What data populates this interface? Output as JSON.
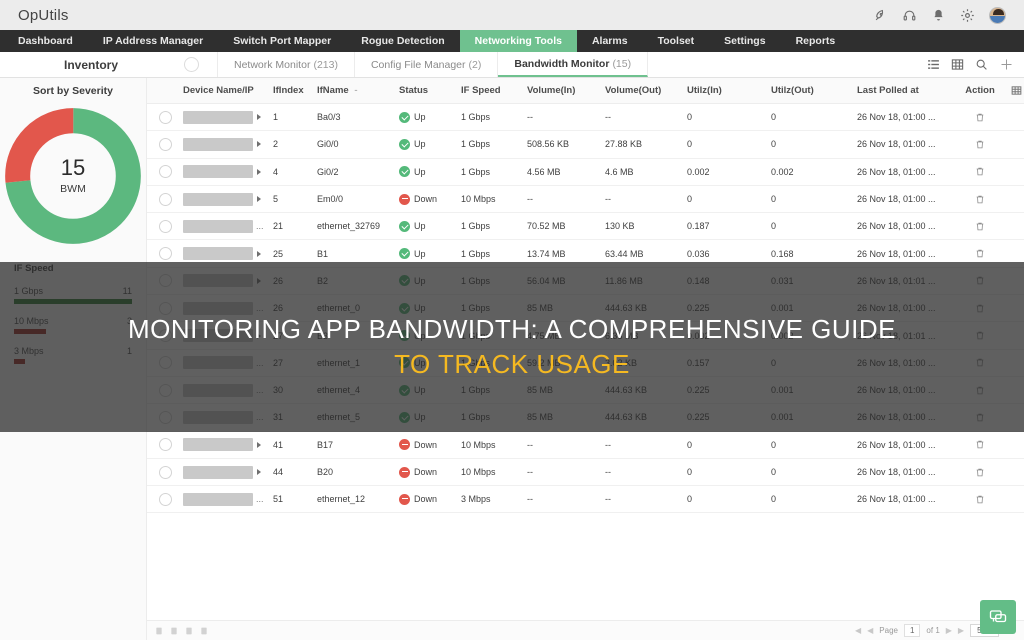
{
  "brand": {
    "name": "OpUtils"
  },
  "top_icons": [
    {
      "name": "rocket-icon"
    },
    {
      "name": "headset-icon"
    },
    {
      "name": "bell-icon"
    },
    {
      "name": "gear-icon"
    },
    {
      "name": "avatar"
    }
  ],
  "nav": {
    "items": [
      {
        "label": "Dashboard",
        "active": false
      },
      {
        "label": "IP Address Manager",
        "active": false
      },
      {
        "label": "Switch Port Mapper",
        "active": false
      },
      {
        "label": "Rogue Detection",
        "active": false
      },
      {
        "label": "Networking Tools",
        "active": true
      },
      {
        "label": "Alarms",
        "active": false
      },
      {
        "label": "Toolset",
        "active": false
      },
      {
        "label": "Settings",
        "active": false
      },
      {
        "label": "Reports",
        "active": false
      }
    ],
    "active_color": "#6fc18f"
  },
  "subbar": {
    "inventory_label": "Inventory",
    "tabs": [
      {
        "label": "Network Monitor",
        "count": "(213)",
        "active": false
      },
      {
        "label": "Config File Manager",
        "count": "(2)",
        "active": false
      },
      {
        "label": "Bandwidth Monitor",
        "count": "(15)",
        "active": true
      }
    ],
    "icons": [
      {
        "name": "list-view-icon"
      },
      {
        "name": "grid-view-icon"
      },
      {
        "name": "search-icon"
      },
      {
        "name": "add-icon"
      }
    ]
  },
  "sidebar": {
    "sort_title": "Sort by Severity",
    "donut": {
      "total": "15",
      "unit": "BWM",
      "segments": [
        {
          "label": "Up",
          "value": 11,
          "color": "#5cb87f"
        },
        {
          "label": "Down",
          "value": 4,
          "color": "#e2574c"
        }
      ]
    },
    "ifspeed": {
      "title": "IF Speed",
      "rows": [
        {
          "label": "1 Gbps",
          "count": "11",
          "pct": 100,
          "color": "#2e7d32"
        },
        {
          "label": "10 Mbps",
          "count": "3",
          "pct": 27,
          "color": "#9e2b25"
        },
        {
          "label": "3 Mbps",
          "count": "1",
          "pct": 9,
          "color": "#9e2b25"
        }
      ]
    }
  },
  "table": {
    "columns": [
      "Device Name/IP",
      "IfIndex",
      "IfName",
      "Status",
      "IF Speed",
      "Volume(In)",
      "Volume(Out)",
      "Utilz(In)",
      "Utilz(Out)",
      "Last Polled at",
      "Action"
    ],
    "sorted_column": "IfName",
    "rows": [
      {
        "ifindex": "1",
        "ifname": "Ba0/3",
        "status": "Up",
        "speed": "1 Gbps",
        "vol_in": "--",
        "vol_out": "--",
        "utl_in": "0",
        "utl_out": "0",
        "polled": "26 Nov 18, 01:00 ...",
        "truncated": false
      },
      {
        "ifindex": "2",
        "ifname": "Gi0/0",
        "status": "Up",
        "speed": "1 Gbps",
        "vol_in": "508.56 KB",
        "vol_out": "27.88 KB",
        "utl_in": "0",
        "utl_out": "0",
        "polled": "26 Nov 18, 01:00 ...",
        "truncated": false
      },
      {
        "ifindex": "4",
        "ifname": "Gi0/2",
        "status": "Up",
        "speed": "1 Gbps",
        "vol_in": "4.56 MB",
        "vol_out": "4.6 MB",
        "utl_in": "0.002",
        "utl_out": "0.002",
        "polled": "26 Nov 18, 01:00 ...",
        "truncated": false
      },
      {
        "ifindex": "5",
        "ifname": "Em0/0",
        "status": "Down",
        "speed": "10 Mbps",
        "vol_in": "--",
        "vol_out": "--",
        "utl_in": "0",
        "utl_out": "0",
        "polled": "26 Nov 18, 01:00 ...",
        "truncated": false
      },
      {
        "ifindex": "21",
        "ifname": "ethernet_32769",
        "status": "Up",
        "speed": "1 Gbps",
        "vol_in": "70.52 MB",
        "vol_out": "130 KB",
        "utl_in": "0.187",
        "utl_out": "0",
        "polled": "26 Nov 18, 01:00 ...",
        "truncated": true
      },
      {
        "ifindex": "25",
        "ifname": "B1",
        "status": "Up",
        "speed": "1 Gbps",
        "vol_in": "13.74 MB",
        "vol_out": "63.44 MB",
        "utl_in": "0.036",
        "utl_out": "0.168",
        "polled": "26 Nov 18, 01:00 ...",
        "truncated": false
      },
      {
        "ifindex": "26",
        "ifname": "B2",
        "status": "Up",
        "speed": "1 Gbps",
        "vol_in": "56.04 MB",
        "vol_out": "11.86 MB",
        "utl_in": "0.148",
        "utl_out": "0.031",
        "polled": "26 Nov 18, 01:01 ...",
        "truncated": false
      },
      {
        "ifindex": "26",
        "ifname": "ethernet_0",
        "status": "Up",
        "speed": "1 Gbps",
        "vol_in": "85 MB",
        "vol_out": "444.63 KB",
        "utl_in": "0.225",
        "utl_out": "0.001",
        "polled": "26 Nov 18, 01:00 ...",
        "truncated": true
      },
      {
        "ifindex": "27",
        "ifname": "B3",
        "status": "Up",
        "speed": "1 Gbps",
        "vol_in": "4.75 MB",
        "vol_out": "6.33 MB",
        "utl_in": "0.002",
        "utl_out": "0.002",
        "polled": "26 Nov 18, 01:01 ...",
        "truncated": false
      },
      {
        "ifindex": "27",
        "ifname": "ethernet_1",
        "status": "Up",
        "speed": "1 Gbps",
        "vol_in": "59.2 MB",
        "vol_out": "3.02 KB",
        "utl_in": "0.157",
        "utl_out": "0",
        "polled": "26 Nov 18, 01:00 ...",
        "truncated": true
      },
      {
        "ifindex": "30",
        "ifname": "ethernet_4",
        "status": "Up",
        "speed": "1 Gbps",
        "vol_in": "85 MB",
        "vol_out": "444.63 KB",
        "utl_in": "0.225",
        "utl_out": "0.001",
        "polled": "26 Nov 18, 01:00 ...",
        "truncated": true
      },
      {
        "ifindex": "31",
        "ifname": "ethernet_5",
        "status": "Up",
        "speed": "1 Gbps",
        "vol_in": "85 MB",
        "vol_out": "444.63 KB",
        "utl_in": "0.225",
        "utl_out": "0.001",
        "polled": "26 Nov 18, 01:00 ...",
        "truncated": true
      },
      {
        "ifindex": "41",
        "ifname": "B17",
        "status": "Down",
        "speed": "10 Mbps",
        "vol_in": "--",
        "vol_out": "--",
        "utl_in": "0",
        "utl_out": "0",
        "polled": "26 Nov 18, 01:00 ...",
        "truncated": false
      },
      {
        "ifindex": "44",
        "ifname": "B20",
        "status": "Down",
        "speed": "10 Mbps",
        "vol_in": "--",
        "vol_out": "--",
        "utl_in": "0",
        "utl_out": "0",
        "polled": "26 Nov 18, 01:00 ...",
        "truncated": false
      },
      {
        "ifindex": "51",
        "ifname": "ethernet_12",
        "status": "Down",
        "speed": "3 Mbps",
        "vol_in": "--",
        "vol_out": "--",
        "utl_in": "0",
        "utl_out": "0",
        "polled": "26 Nov 18, 01:00 ...",
        "truncated": true
      }
    ]
  },
  "footer": {
    "page_label": "Page",
    "page_value": "1",
    "of_label": "of 1",
    "page_size": "50"
  },
  "overlay": {
    "line1": "MONITORING APP BANDWIDTH: A COMPREHENSIVE GUIDE",
    "line2": "TO TRACK USAGE",
    "line1_color": "#ffffff",
    "line2_color": "#f5b921"
  },
  "chat": {
    "icon_name": "chat-icon",
    "color": "#63bd87"
  }
}
